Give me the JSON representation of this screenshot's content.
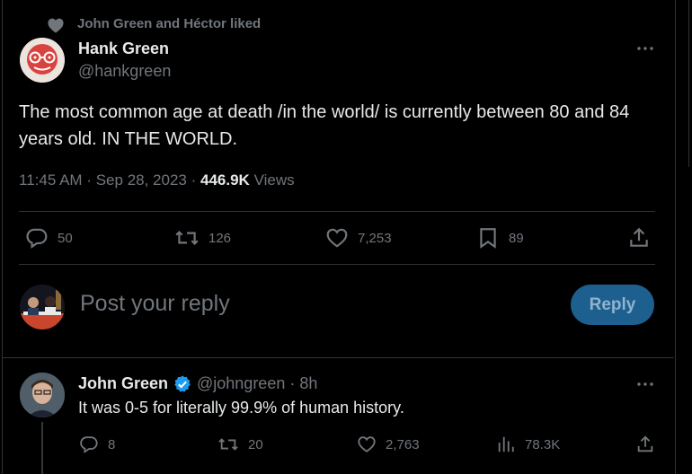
{
  "social_context": "John Green and Héctor liked",
  "tweet": {
    "author_name": "Hank Green",
    "author_handle": "@hankgreen",
    "text": "The most common age at death /in the world/ is currently between 80 and 84 years old. IN THE WORLD.",
    "time": "11:45 AM",
    "sep1": "·",
    "date": "Sep 28, 2023",
    "sep2": "·",
    "views_count": "446.9K",
    "views_label": "Views",
    "replies": "50",
    "reposts": "126",
    "likes": "7,253",
    "bookmarks": "89"
  },
  "composer": {
    "placeholder": "Post your reply",
    "button_label": "Reply"
  },
  "reply": {
    "author_name": "John Green",
    "author_handle": "@johngreen",
    "dot": "·",
    "age": "8h",
    "text": "It was 0-5 for literally 99.9% of human history.",
    "replies": "8",
    "reposts": "20",
    "likes": "2,763",
    "views": "78.3K"
  },
  "colors": {
    "background": "#000000",
    "text_primary": "#e7e9ea",
    "text_secondary": "#71767b",
    "divider": "#2f3336",
    "reply_button": "#1d5f8f",
    "verified_badge": "#1d9bf0"
  },
  "icons": {
    "context": "heart-icon",
    "more": "more-horizontal-icon",
    "reply": "reply-bubble-icon",
    "repost": "repost-icon",
    "like": "heart-outline-icon",
    "bookmark": "bookmark-icon",
    "share": "share-icon",
    "views": "bar-chart-icon",
    "verified": "verified-badge-icon"
  }
}
